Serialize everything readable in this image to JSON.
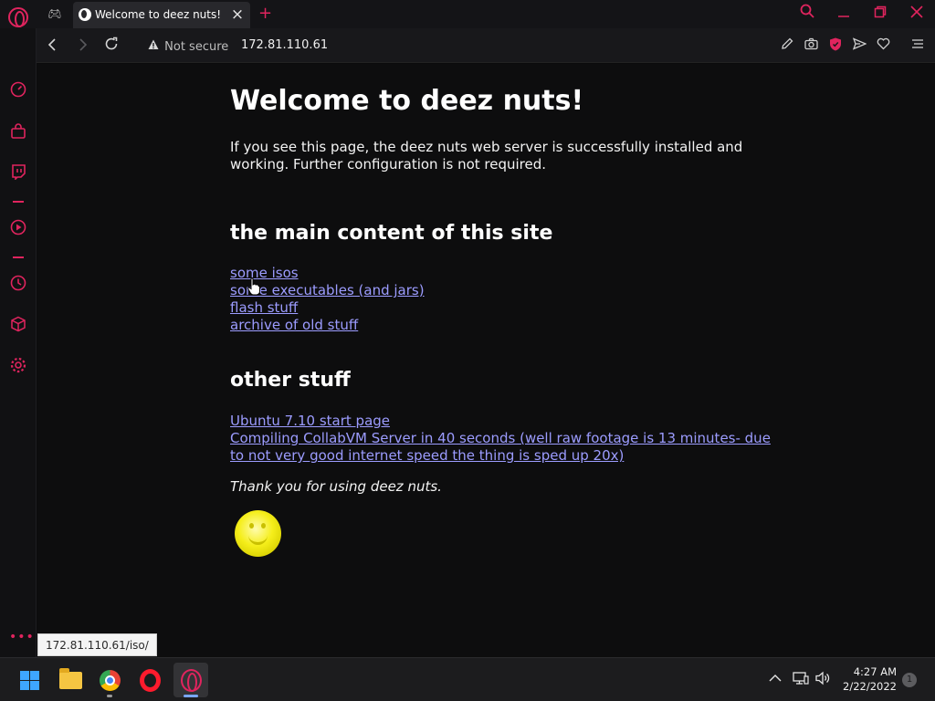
{
  "browser": {
    "tab": {
      "title": "Welcome to deez nuts!"
    },
    "toolbar": {
      "security_text": "Not secure",
      "address": "172.81.110.61"
    },
    "status_url": "172.81.110.61/iso/"
  },
  "icons": {
    "tabstrip": [
      "opera-logo-icon",
      "gx-control-icon",
      "globe-favicon-icon",
      "close-icon",
      "plus-icon",
      "search-icon",
      "minimize-icon",
      "restore-icon",
      "close-window-icon"
    ],
    "toolbar": [
      "back-icon",
      "forward-icon",
      "reload-icon",
      "warning-icon",
      "edit-icon",
      "camera-icon",
      "shield-icon",
      "send-icon",
      "heart-icon",
      "menu-icon"
    ],
    "sidebar": [
      "speed-dial-icon",
      "bag-icon",
      "twitch-icon",
      "player-icon",
      "history-icon",
      "cube-icon",
      "settings-icon",
      "more-icon"
    ]
  },
  "page": {
    "title": "Welcome to deez nuts!",
    "intro": "If you see this page, the deez nuts web server is successfully installed and working. Further configuration is not required.",
    "main_heading": "the main content of this site",
    "main_links": [
      "some isos",
      "some executables (and jars)",
      "flash stuff",
      "archive of old stuff"
    ],
    "other_heading": "other stuff",
    "other_links": [
      "Ubuntu 7.10 start page",
      "Compiling CollabVM Server in 40 seconds (well raw footage is 13 minutes- due to not very good internet speed the thing is sped up 20x)"
    ],
    "thanks": "Thank you for using deez nuts."
  },
  "taskbar": {
    "apps": [
      "windows-start",
      "file-explorer",
      "google-chrome",
      "opera",
      "opera-gx"
    ],
    "time": "4:27 AM",
    "date": "2/22/2022",
    "notification_count": "1"
  },
  "colors": {
    "accent": "#e0245e",
    "link": "#9c9cff",
    "page_bg": "#0d0d0e"
  }
}
